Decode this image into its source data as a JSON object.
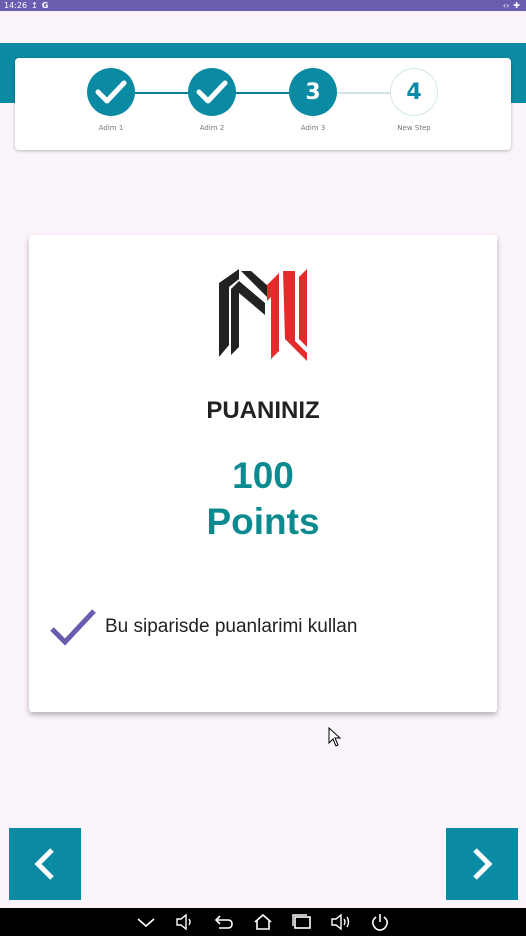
{
  "status_bar": {
    "time": "14:26",
    "app_icon": "G",
    "left_icons": [
      "upload-icon",
      "google-icon"
    ],
    "right_icons": [
      "code-icon",
      "plus-icon"
    ]
  },
  "stepper": {
    "steps": [
      {
        "label": "Adim 1",
        "state": "done",
        "number": ""
      },
      {
        "label": "Adim 2",
        "state": "done",
        "number": ""
      },
      {
        "label": "Adim 3",
        "state": "current",
        "number": "3"
      },
      {
        "label": "New Step",
        "state": "pending",
        "number": "4"
      }
    ]
  },
  "card": {
    "logo": "brand-logo",
    "title": "PUANINIZ",
    "points_amount": "100",
    "points_unit": "Points",
    "use_points_label": "Bu siparisde puanlarimi kullan",
    "use_points_checked": true
  },
  "nav": {
    "back_icon": "chevron-left-icon",
    "next_icon": "chevron-right-icon"
  },
  "system_bar": {
    "icons": [
      "collapse-icon",
      "volume-down-icon",
      "back-icon",
      "home-icon",
      "recents-icon",
      "volume-up-icon",
      "power-icon"
    ]
  },
  "colors": {
    "status_bar": "#6a5caf",
    "accent": "#0b8aa3",
    "points": "#0b8a8f",
    "check": "#6a5caf",
    "logo_dark": "#222222",
    "logo_red": "#e32b2b"
  }
}
